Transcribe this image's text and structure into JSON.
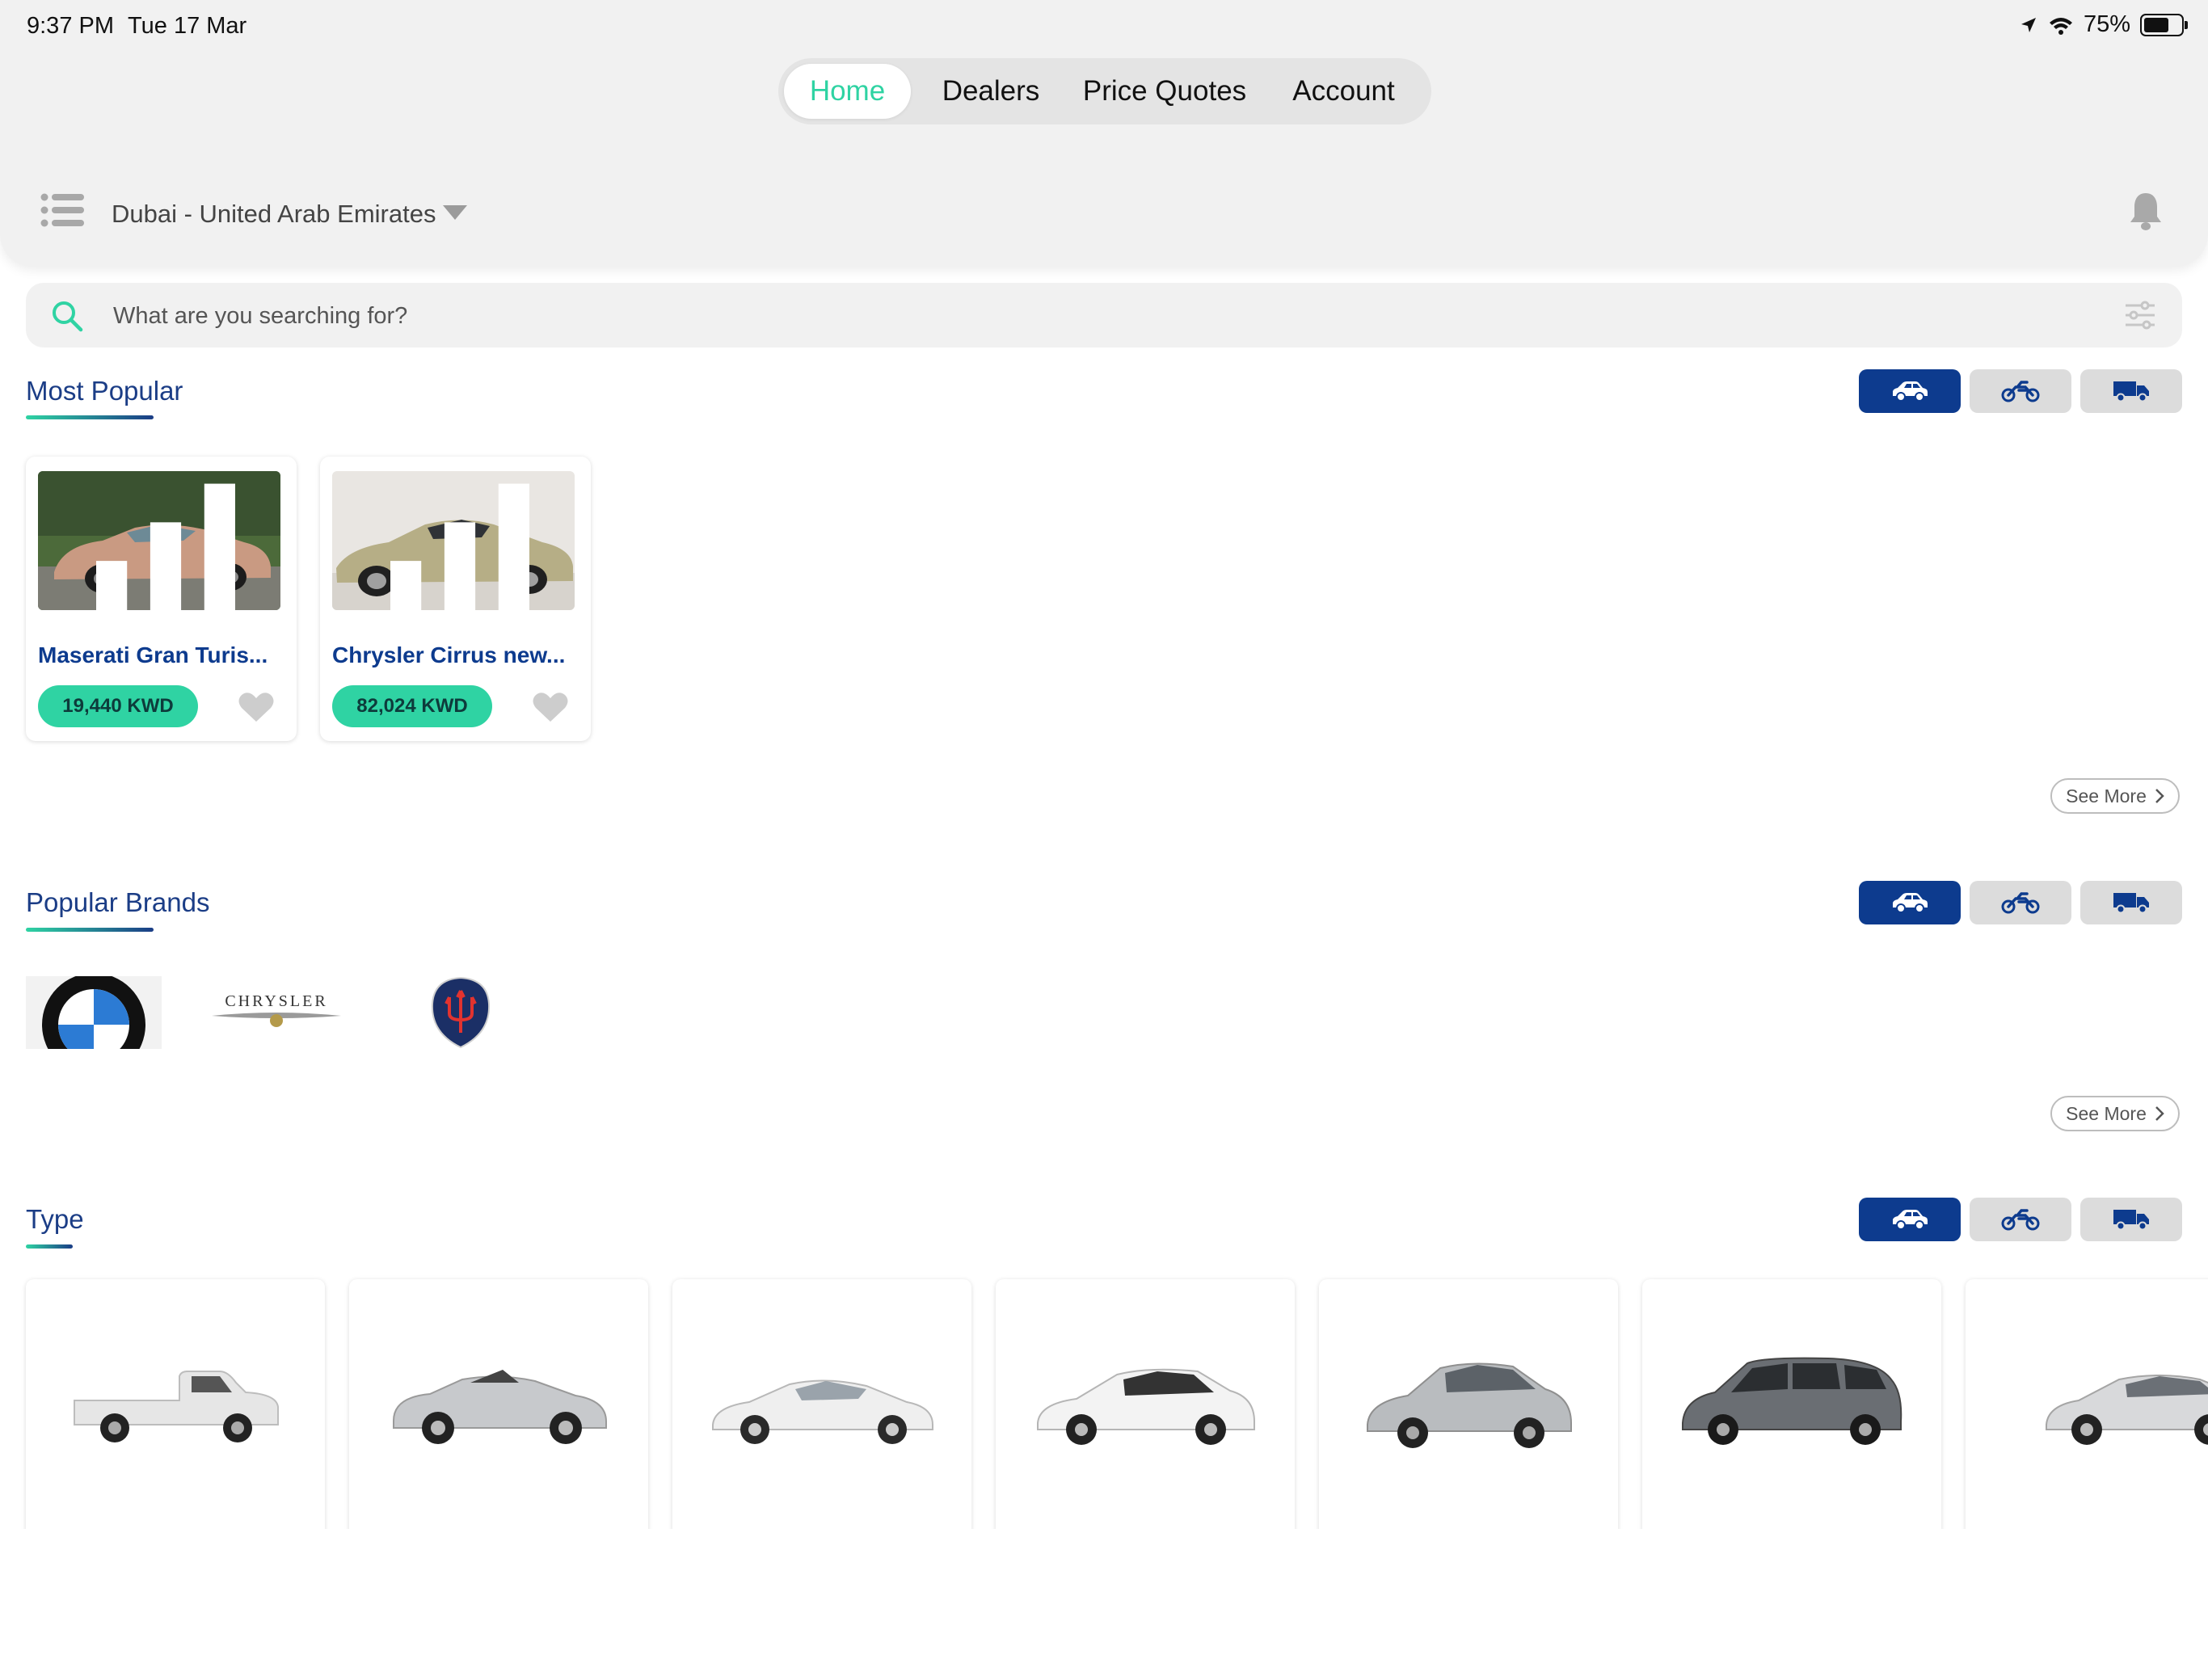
{
  "status_bar": {
    "time": "9:37 PM",
    "date": "Tue 17 Mar",
    "battery": "75%",
    "battery_level": 0.75
  },
  "nav": {
    "tabs": [
      {
        "label": "Home",
        "active": true
      },
      {
        "label": "Dealers",
        "active": false
      },
      {
        "label": "Price Quotes",
        "active": false
      },
      {
        "label": "Account",
        "active": false
      }
    ]
  },
  "header": {
    "location": "Dubai - United Arab Emirates"
  },
  "search": {
    "placeholder": "What are you searching for?",
    "value": ""
  },
  "vehicle_toggles": [
    "car-icon",
    "motorcycle-icon",
    "truck-icon"
  ],
  "sections": {
    "most_popular": {
      "title": "Most Popular",
      "see_more": "See More",
      "cards": [
        {
          "name": "Maserati Gran Turis...",
          "price": "19,440 KWD"
        },
        {
          "name": "Chrysler Cirrus new...",
          "price": "82,024 KWD"
        }
      ]
    },
    "popular_brands": {
      "title": "Popular Brands",
      "see_more": "See More",
      "brands": [
        "BMW",
        "CHRYSLER",
        "MASERATI"
      ]
    },
    "type": {
      "title": "Type",
      "types": [
        "pickup",
        "convertible",
        "coupe",
        "hatchback",
        "sedan",
        "van",
        "luxury"
      ]
    }
  },
  "colors": {
    "accent_green": "#2fd3a3",
    "brand_navy": "#0d3b8e",
    "title_blue": "#1b3d86",
    "panel_gray": "#f1f1f1"
  }
}
